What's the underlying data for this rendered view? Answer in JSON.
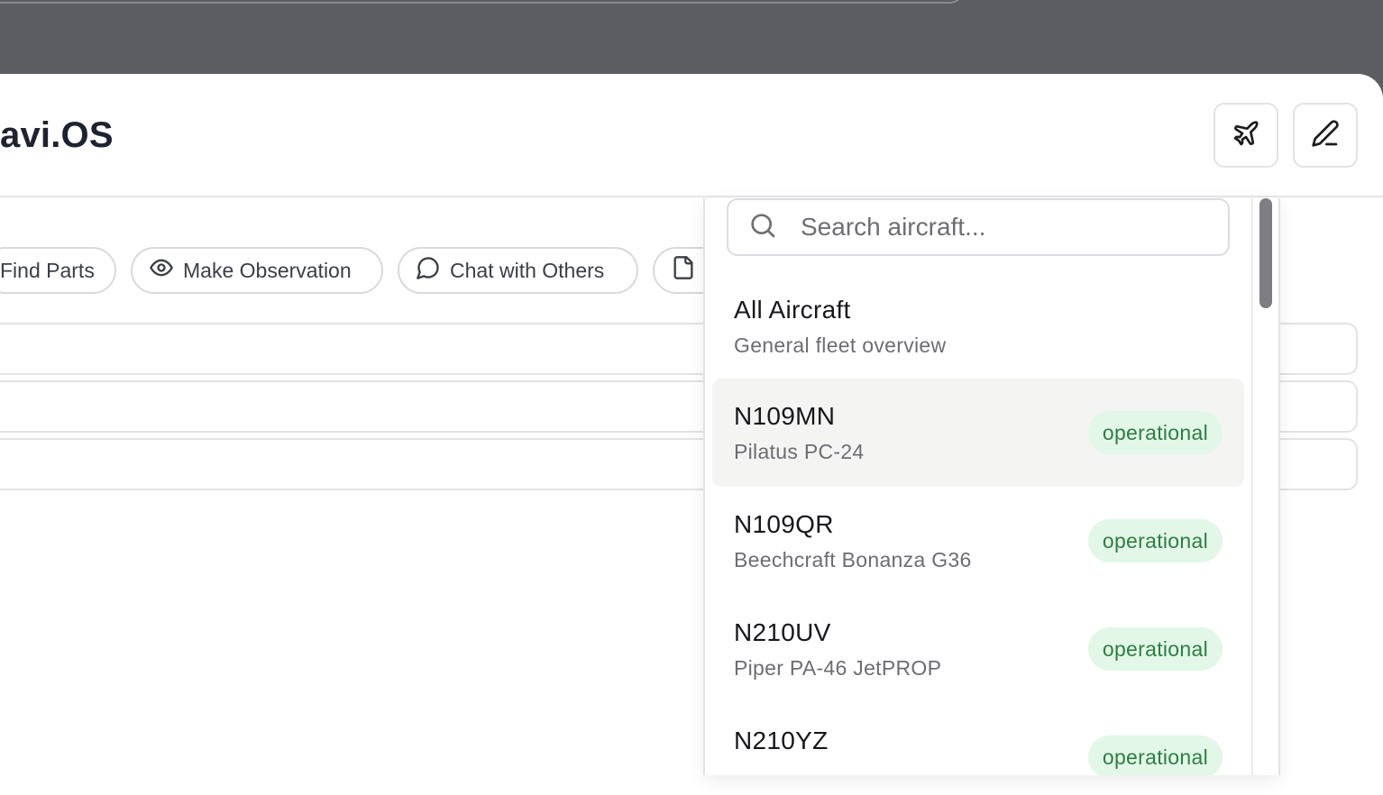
{
  "app": {
    "title": "avi.OS"
  },
  "header": {
    "buttons": [
      {
        "icon": "plane-icon"
      },
      {
        "icon": "pencil-icon"
      }
    ]
  },
  "actions": [
    {
      "label": "Find Parts",
      "icon": ""
    },
    {
      "label": "Make Observation",
      "icon": "eye-icon"
    },
    {
      "label": "Chat with Others",
      "icon": "chat-bubble-icon"
    },
    {
      "label": "",
      "icon": "document-icon"
    }
  ],
  "aircraft_picker": {
    "search_placeholder": "Search aircraft...",
    "all": {
      "title": "All Aircraft",
      "subtitle": "General fleet overview"
    },
    "items": [
      {
        "tail": "N109MN",
        "model": "Pilatus PC-24",
        "status": "operational"
      },
      {
        "tail": "N109QR",
        "model": "Beechcraft Bonanza G36",
        "status": "operational"
      },
      {
        "tail": "N210UV",
        "model": "Piper PA-46 JetPROP",
        "status": "operational"
      },
      {
        "tail": "N210YZ",
        "model": "",
        "status": "operational"
      }
    ]
  },
  "colors": {
    "backdrop": "#5c5d61",
    "status_bg": "#e2f7e7",
    "status_text": "#2f7d44",
    "active_row": "#f4f4f3"
  }
}
